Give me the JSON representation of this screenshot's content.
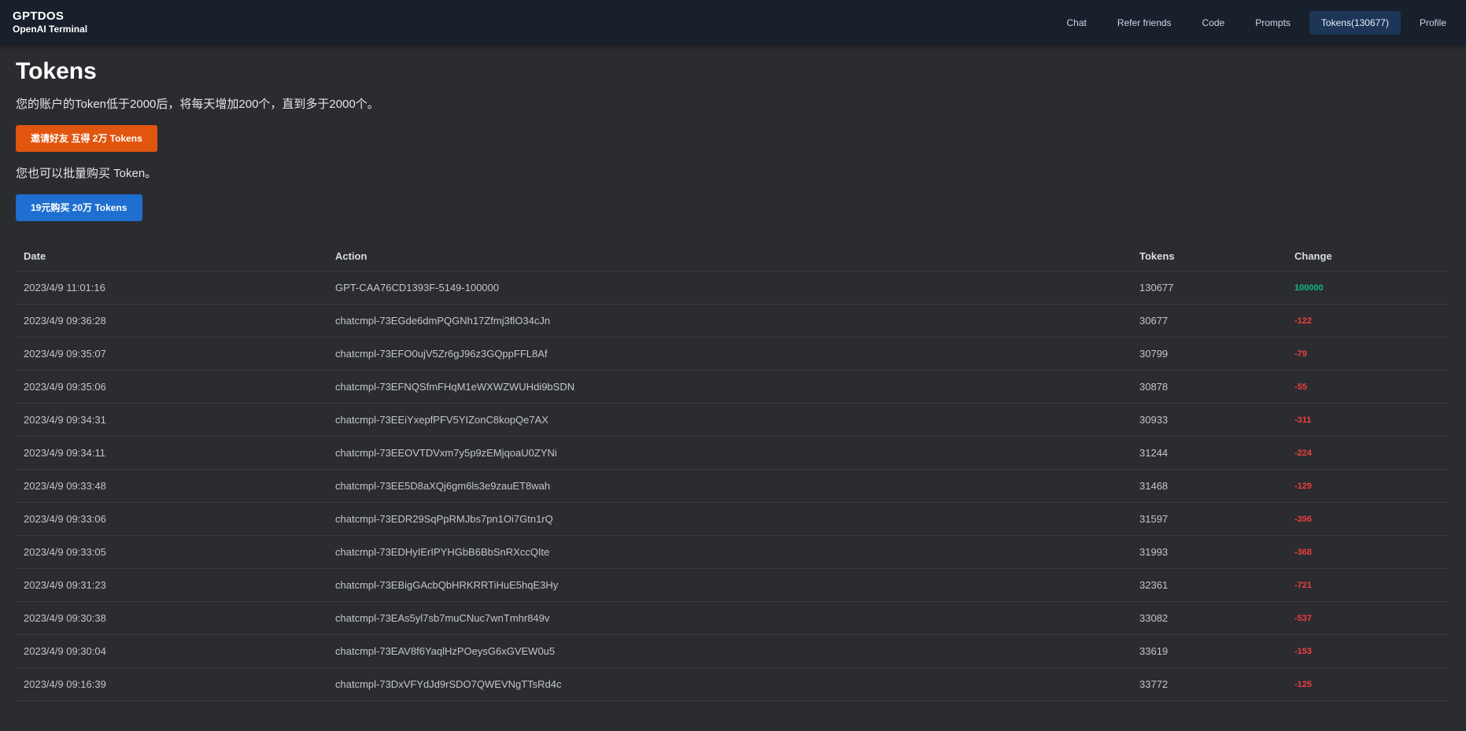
{
  "brand": {
    "name": "GPTDOS",
    "subtitle": "OpenAI Terminal"
  },
  "nav": {
    "chat": "Chat",
    "refer": "Refer friends",
    "code": "Code",
    "prompts": "Prompts",
    "tokens": "Tokens(130677)",
    "profile": "Profile"
  },
  "page": {
    "title": "Tokens",
    "description": "您的账户的Token低于2000后，将每天增加200个，直到多于2000个。",
    "invite_button": "邀请好友 互得 2万 Tokens",
    "buy_description": "您也可以批量购买 Token。",
    "buy_button": "19元购买 20万 Tokens"
  },
  "table": {
    "headers": {
      "date": "Date",
      "action": "Action",
      "tokens": "Tokens",
      "change": "Change"
    },
    "rows": [
      {
        "date": "2023/4/9 11:01:16",
        "action": "GPT-CAA76CD1393F-5149-100000",
        "tokens": "130677",
        "change": "100000"
      },
      {
        "date": "2023/4/9 09:36:28",
        "action": "chatcmpl-73EGde6dmPQGNh17Zfmj3flO34cJn",
        "tokens": "30677",
        "change": "-122"
      },
      {
        "date": "2023/4/9 09:35:07",
        "action": "chatcmpl-73EFO0ujV5Zr6gJ96z3GQppFFL8Af",
        "tokens": "30799",
        "change": "-79"
      },
      {
        "date": "2023/4/9 09:35:06",
        "action": "chatcmpl-73EFNQSfmFHqM1eWXWZWUHdi9bSDN",
        "tokens": "30878",
        "change": "-55"
      },
      {
        "date": "2023/4/9 09:34:31",
        "action": "chatcmpl-73EEiYxepfPFV5YIZonC8kopQe7AX",
        "tokens": "30933",
        "change": "-311"
      },
      {
        "date": "2023/4/9 09:34:11",
        "action": "chatcmpl-73EEOVTDVxm7y5p9zEMjqoaU0ZYNi",
        "tokens": "31244",
        "change": "-224"
      },
      {
        "date": "2023/4/9 09:33:48",
        "action": "chatcmpl-73EE5D8aXQj6gm6ls3e9zauET8wah",
        "tokens": "31468",
        "change": "-129"
      },
      {
        "date": "2023/4/9 09:33:06",
        "action": "chatcmpl-73EDR29SqPpRMJbs7pn1Oi7Gtn1rQ",
        "tokens": "31597",
        "change": "-396"
      },
      {
        "date": "2023/4/9 09:33:05",
        "action": "chatcmpl-73EDHyIErIPYHGbB6BbSnRXccQIte",
        "tokens": "31993",
        "change": "-368"
      },
      {
        "date": "2023/4/9 09:31:23",
        "action": "chatcmpl-73EBigGAcbQbHRKRRTiHuE5hqE3Hy",
        "tokens": "32361",
        "change": "-721"
      },
      {
        "date": "2023/4/9 09:30:38",
        "action": "chatcmpl-73EAs5yl7sb7muCNuc7wnTmhr849v",
        "tokens": "33082",
        "change": "-537"
      },
      {
        "date": "2023/4/9 09:30:04",
        "action": "chatcmpl-73EAV8f6YaqlHzPOeysG6xGVEW0u5",
        "tokens": "33619",
        "change": "-153"
      },
      {
        "date": "2023/4/9 09:16:39",
        "action": "chatcmpl-73DxVFYdJd9rSDO7QWEVNgTTsRd4c",
        "tokens": "33772",
        "change": "-125"
      }
    ]
  },
  "colors": {
    "positive_change": "#12b886",
    "negative_change": "#f03e3e",
    "invite_button": "#e2550f",
    "buy_button": "#1e6fd0"
  }
}
